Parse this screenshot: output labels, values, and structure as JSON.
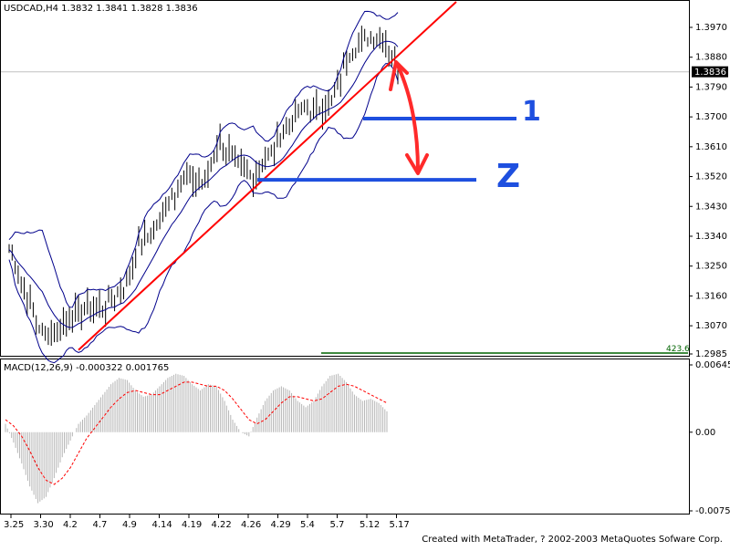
{
  "window": {
    "symbol_header": "USDCAD,H4  1.3832 1.3841 1.3828 1.3836",
    "macd_header": "MACD(12,26,9)  -0.000322  0.001765",
    "footer": "Created with MetaTrader, ? 2002-2003 MetaQuotes Sofware Corp."
  },
  "colors": {
    "background": "#ffffff",
    "bars": "#000000",
    "bollinger": "#00008b",
    "trendline": "#ff0000",
    "level_lines": "#1e4fdf",
    "arrow": "#ff2a2a",
    "macd_hist": "#b5b5b5",
    "macd_signal": "#ff0000",
    "green_line": "#006400"
  },
  "chart_data": [
    {
      "type": "line",
      "panel": "price",
      "ylim": [
        1.2985,
        1.4025
      ],
      "yticks": [
        "1.3970",
        "1.3880",
        "1.3790",
        "1.3700",
        "1.3610",
        "1.3520",
        "1.3430",
        "1.3340",
        "1.3250",
        "1.3160",
        "1.3070",
        "1.2985"
      ],
      "current_price_label": "1.3836",
      "x_categories": [
        "3.25",
        "3.30",
        "4.2",
        "4.7",
        "4.9",
        "4.14",
        "4.19",
        "4.22",
        "4.26",
        "4.29",
        "5.4",
        "5.7",
        "5.12",
        "5.17"
      ],
      "close_path": [
        [
          0,
          1.33
        ],
        [
          1,
          1.318
        ],
        [
          2,
          1.305
        ],
        [
          3,
          1.306
        ],
        [
          4,
          1.311
        ],
        [
          5,
          1.312
        ],
        [
          6,
          1.313
        ],
        [
          7,
          1.318
        ],
        [
          8,
          1.331
        ],
        [
          9,
          1.336
        ],
        [
          10,
          1.346
        ],
        [
          11,
          1.352
        ],
        [
          12,
          1.35
        ],
        [
          13,
          1.363
        ],
        [
          14,
          1.356
        ],
        [
          15,
          1.352
        ],
        [
          16,
          1.358
        ],
        [
          17,
          1.366
        ],
        [
          18,
          1.372
        ],
        [
          19,
          1.372
        ],
        [
          20,
          1.375
        ],
        [
          21,
          1.39
        ],
        [
          22,
          1.394
        ],
        [
          23,
          1.395
        ],
        [
          24,
          1.384
        ]
      ],
      "annotations": {
        "level_1_label": "1",
        "level_2_label": "Z",
        "level_1_price": 1.3695,
        "level_2_price": 1.351,
        "green_level_label": "423.6"
      }
    },
    {
      "type": "bar",
      "panel": "macd",
      "ylim": [
        -0.00754,
        0.00645
      ],
      "yticks": [
        "0.00645",
        "0.00",
        "-0.00754"
      ],
      "histogram": [
        0.0008,
        -0.001,
        -0.003,
        -0.0052,
        -0.0068,
        -0.0062,
        -0.0044,
        -0.0024,
        -0.0008,
        0.0008,
        0.0016,
        0.0026,
        0.0036,
        0.0046,
        0.0052,
        0.005,
        0.004,
        0.0034,
        0.0036,
        0.0044,
        0.0052,
        0.0056,
        0.0054,
        0.0046,
        0.004,
        0.0046,
        0.0044,
        0.003,
        0.0012,
        0.0,
        -0.0004,
        0.0014,
        0.003,
        0.004,
        0.0044,
        0.004,
        0.003,
        0.0024,
        0.003,
        0.0044,
        0.0054,
        0.0056,
        0.0048,
        0.0036,
        0.003,
        0.0032,
        0.0028,
        0.002
      ],
      "signal": [
        0.0012,
        0.0006,
        -0.0004,
        -0.0018,
        -0.0034,
        -0.0046,
        -0.005,
        -0.0044,
        -0.0034,
        -0.002,
        -0.0006,
        0.0004,
        0.0014,
        0.0024,
        0.0032,
        0.0038,
        0.004,
        0.0038,
        0.0036,
        0.0036,
        0.004,
        0.0044,
        0.0048,
        0.0048,
        0.0046,
        0.0044,
        0.0044,
        0.004,
        0.0032,
        0.0022,
        0.0012,
        0.0008,
        0.0012,
        0.002,
        0.0028,
        0.0034,
        0.0034,
        0.0032,
        0.003,
        0.0032,
        0.0038,
        0.0044,
        0.0046,
        0.0044,
        0.004,
        0.0036,
        0.0032,
        0.0028
      ]
    }
  ]
}
